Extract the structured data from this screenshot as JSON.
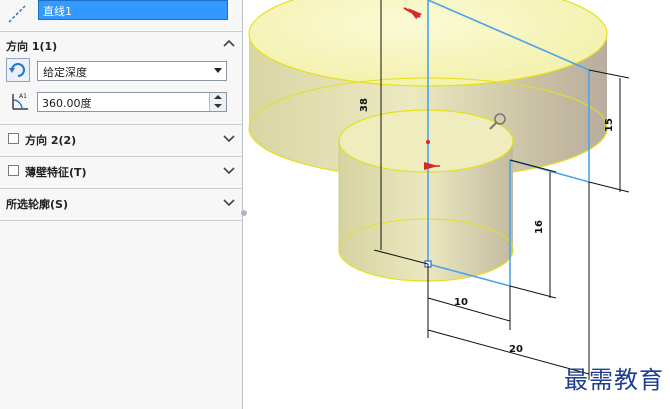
{
  "panel": {
    "axis_value": "直线1",
    "direction1": {
      "title": "方向 1(1)",
      "end_condition": "给定深度",
      "angle_value": "360.00度"
    },
    "direction2": {
      "title": "方向 2(2)"
    },
    "thin_feature": {
      "title": "薄壁特征(T)"
    },
    "selected_contours": {
      "title": "所选轮廓(S)"
    }
  },
  "viewport": {
    "dimensions": {
      "d38": "38",
      "d15": "15",
      "d16": "16",
      "d10": "10",
      "d20": "20"
    }
  },
  "watermark": "最需教育",
  "colors": {
    "highlight_blue": "#3399ff",
    "sketch_blue": "#4aa3e8",
    "solid_yellow": "#f3f0a8",
    "edge_yellow": "#e8e21a"
  }
}
